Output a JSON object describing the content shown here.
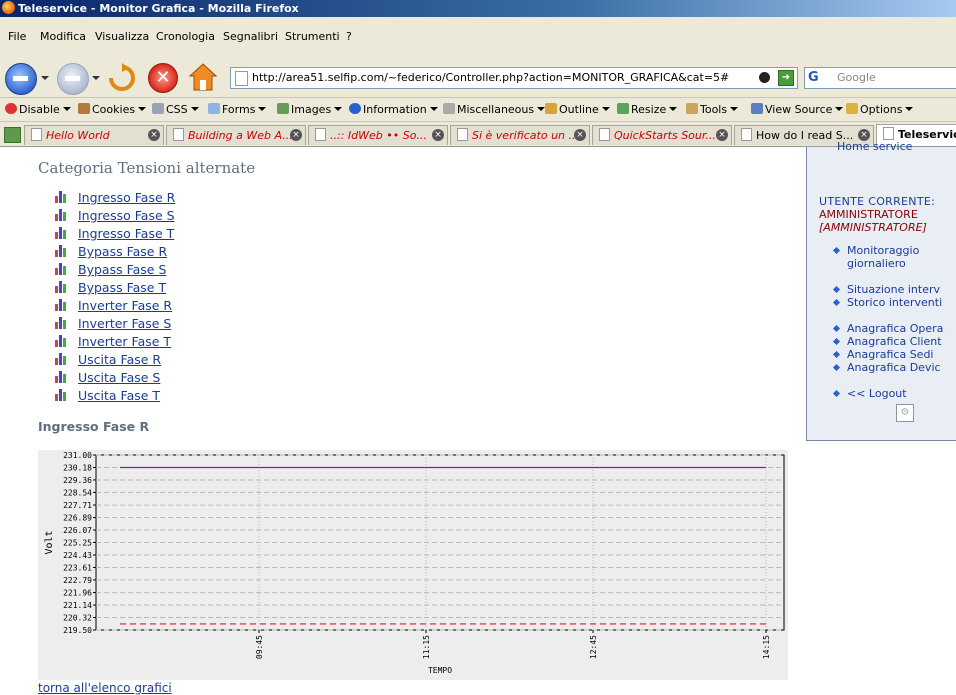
{
  "window": {
    "title": "Teleservice - Monitor Grafica - Mozilla Firefox"
  },
  "menu": [
    "File",
    "Modifica",
    "Visualizza",
    "Cronologia",
    "Segnalibri",
    "Strumenti",
    "?"
  ],
  "address_bar": {
    "url": "http://area51.selfip.com/~federico/Controller.php?action=MONITOR_GRAFICA&cat=5#"
  },
  "search": {
    "engine": "G",
    "placeholder": "Google"
  },
  "dev_toolbar": [
    "Disable",
    "Cookies",
    "CSS",
    "Forms",
    "Images",
    "Information",
    "Miscellaneous",
    "Outline",
    "Resize",
    "Tools",
    "View Source",
    "Options"
  ],
  "tabs": [
    {
      "label": "Hello World",
      "style": "red"
    },
    {
      "label": "Building a Web A...",
      "style": "red"
    },
    {
      "label": "..:: IdWeb •• So...",
      "style": "red"
    },
    {
      "label": "Si è verificato un ...",
      "style": "red"
    },
    {
      "label": "QuickStarts Sour...",
      "style": "red"
    },
    {
      "label": "How do I read S...",
      "style": "normal"
    },
    {
      "label": "Teleservice",
      "style": "active"
    }
  ],
  "page": {
    "category_title": "Categoria Tensioni alternate",
    "links": [
      "Ingresso Fase R",
      "Ingresso Fase S",
      "Ingresso Fase T",
      "Bypass Fase R",
      "Bypass Fase S",
      "Bypass Fase T",
      "Inverter Fase R",
      "Inverter Fase S",
      "Inverter Fase T",
      "Uscita Fase R",
      "Uscita Fase S",
      "Uscita Fase T"
    ],
    "chart_title": "Ingresso Fase R",
    "back_link": "torna all'elenco grafici"
  },
  "sidebar": {
    "home_service": "Home service",
    "user_label": "UTENTE CORRENTE:",
    "user_name": "AMMINISTRATORE",
    "user_role": "[AMMINISTRATORE]",
    "items": [
      "Monitoraggio giornaliero",
      "Situazione interv",
      "Storico interventi",
      "Anagrafica Opera",
      "Anagrafica Client",
      "Anagrafica Sedi",
      "Anagrafica Devic",
      "<< Logout"
    ]
  },
  "colors": {
    "series_line": "#7b1fa2",
    "threshold_line": "#e31a1c",
    "link": "#1a3c99",
    "heading": "#5f6f7f"
  },
  "chart_data": {
    "type": "line",
    "title": "",
    "xlabel": "TEMPO",
    "ylabel": "Volt",
    "ylim": [
      219.5,
      231.0
    ],
    "yticks": [
      "231.00",
      "230.18",
      "229.36",
      "228.54",
      "227.71",
      "226.89",
      "226.07",
      "225.25",
      "224.43",
      "223.61",
      "222.79",
      "221.96",
      "221.14",
      "220.32",
      "219.50"
    ],
    "xticks": [
      "09:45",
      "11:15",
      "12:45",
      "14:15"
    ],
    "x": [
      "09:45",
      "11:15",
      "12:45",
      "14:15"
    ],
    "series": [
      {
        "values": [
          230.18,
          230.18,
          230.18,
          230.18
        ],
        "style": "solid"
      },
      {
        "values": [
          219.9,
          219.9,
          219.9,
          219.9
        ],
        "style": "dashed"
      }
    ],
    "grid": true
  }
}
